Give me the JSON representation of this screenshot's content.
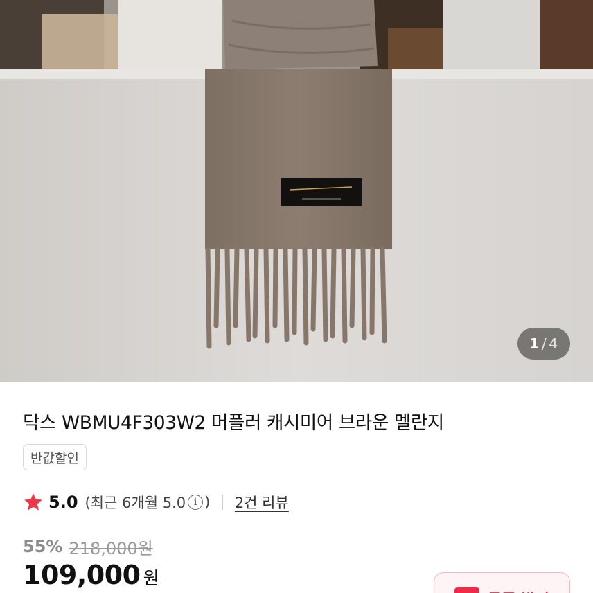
{
  "gallery": {
    "current": "1",
    "separator": "/",
    "total": "4",
    "image_alt": "Brown melange cashmere muffler with fringe draped over a white display",
    "label_line1": "Special collection for DAKS",
    "label_line2": "100% CASHMERE"
  },
  "product": {
    "title": "닥스 WBMU4F303W2 머플러 캐시미어 브라운 멜란지",
    "tag": "반값할인"
  },
  "rating": {
    "icon": "star-icon",
    "score": "5.0",
    "recent_prefix": "(최근 6개월 5.0",
    "recent_suffix": ")",
    "info_icon": "i",
    "reviews_link": "2건 리뷰"
  },
  "price": {
    "discount": "55%",
    "original": "218,000원",
    "sale": "109,000",
    "currency": "원"
  },
  "coupon": {
    "label": "쿠폰 받기",
    "color": "#ef2b47"
  },
  "colors": {
    "accent_red": "#ef2b47",
    "star": "#f0364a"
  }
}
